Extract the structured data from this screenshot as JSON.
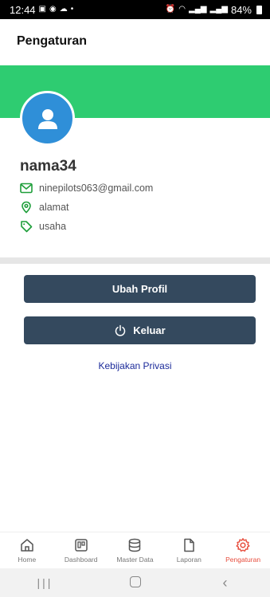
{
  "status_bar": {
    "time": "12:44",
    "left_icons": [
      "image-icon",
      "messenger-icon",
      "cloud-icon",
      "dot-icon"
    ],
    "right_icons": [
      "alarm-icon",
      "wifi-icon",
      "signal-icon",
      "signal-icon",
      "battery-icon"
    ],
    "battery": "84%"
  },
  "header": {
    "title": "Pengaturan"
  },
  "colors": {
    "banner": "#2ecc71",
    "avatar": "#2f8fd8",
    "button": "#34495e",
    "active_nav": "#e74c3c",
    "link": "#1b2a9a"
  },
  "profile": {
    "name": "nama34",
    "email": "ninepilots063@gmail.com",
    "address": "alamat",
    "business": "usaha"
  },
  "actions": {
    "edit_profile": "Ubah Profil",
    "logout": "Keluar",
    "privacy_policy": "Kebijakan Privasi"
  },
  "bottom_nav": [
    {
      "label": "Home",
      "icon": "home-icon",
      "active": false
    },
    {
      "label": "Dashboard",
      "icon": "dashboard-icon",
      "active": false
    },
    {
      "label": "Master Data",
      "icon": "database-icon",
      "active": false
    },
    {
      "label": "Laporan",
      "icon": "file-icon",
      "active": false
    },
    {
      "label": "Pengaturan",
      "icon": "gear-icon",
      "active": true
    }
  ]
}
